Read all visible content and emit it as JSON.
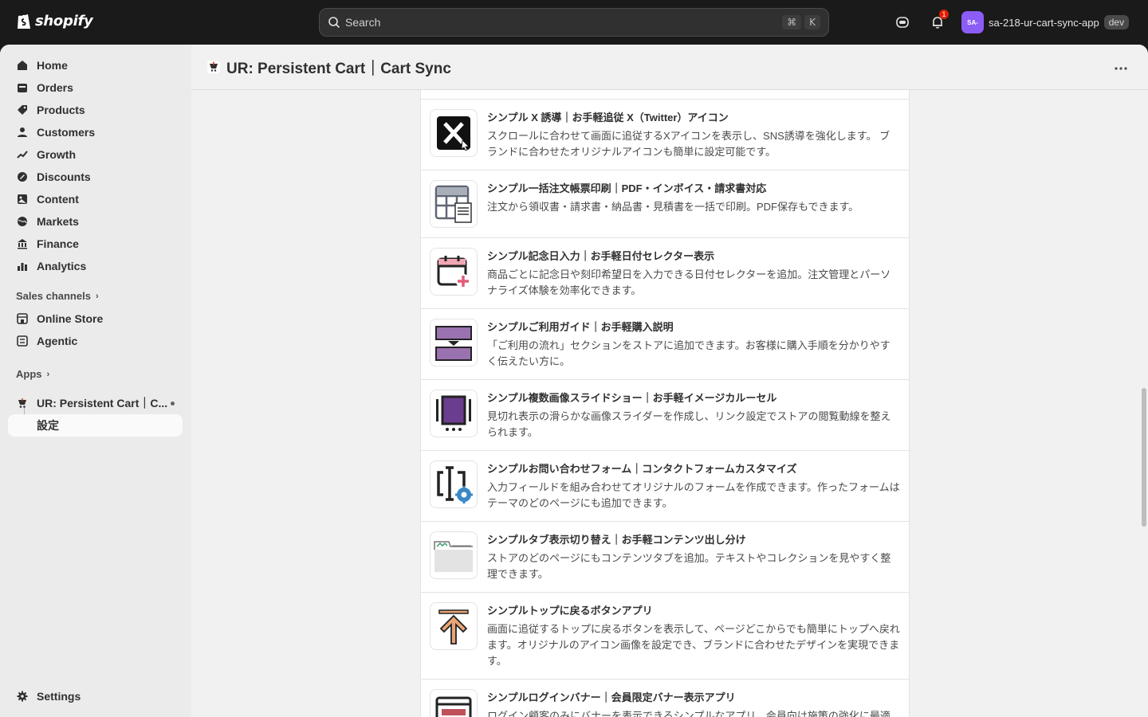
{
  "topbar": {
    "logo_text": "shopify",
    "search_placeholder": "Search",
    "shortcut_cmd": "⌘",
    "shortcut_key": "K",
    "notification_count": "1",
    "avatar_initials": "SA-",
    "account_name": "sa-218-ur-cart-sync-app",
    "env_badge": "dev"
  },
  "sidebar": {
    "items": [
      {
        "label": "Home",
        "icon": "home-icon"
      },
      {
        "label": "Orders",
        "icon": "orders-icon"
      },
      {
        "label": "Products",
        "icon": "tag-icon"
      },
      {
        "label": "Customers",
        "icon": "person-icon"
      },
      {
        "label": "Growth",
        "icon": "growth-icon"
      },
      {
        "label": "Discounts",
        "icon": "discount-icon"
      },
      {
        "label": "Content",
        "icon": "content-icon"
      },
      {
        "label": "Markets",
        "icon": "globe-icon"
      },
      {
        "label": "Finance",
        "icon": "bank-icon"
      },
      {
        "label": "Analytics",
        "icon": "chart-icon"
      }
    ],
    "sales_channels_label": "Sales channels",
    "channels": [
      {
        "label": "Online Store",
        "icon": "store-icon"
      },
      {
        "label": "Agentic",
        "icon": "agentic-icon"
      }
    ],
    "apps_label": "Apps",
    "app_name": "UR: Persistent Cart｜C...",
    "app_sub_item": "設定",
    "settings_label": "Settings"
  },
  "header": {
    "title": "UR: Persistent Cart｜Cart Sync"
  },
  "apps_list": [
    {
      "title": "シンプル X 誘導｜お手軽追従 X（Twitter）アイコン",
      "desc": "スクロールに合わせて画面に追従するXアイコンを表示し、SNS誘導を強化します。 ブランドに合わせたオリジナルアイコンも簡単に設定可能です。",
      "icon": "x-logo-icon"
    },
    {
      "title": "シンプル一括注文帳票印刷｜PDF・インボイス・請求書対応",
      "desc": "注文から領収書・請求書・納品書・見積書を一括で印刷。PDF保存もできます。",
      "icon": "invoice-table-icon"
    },
    {
      "title": "シンプル記念日入力｜お手軽日付セレクター表示",
      "desc": "商品ごとに記念日や刻印希望日を入力できる日付セレクターを追加。注文管理とパーソナライズ体験を効率化できます。",
      "icon": "calendar-add-icon"
    },
    {
      "title": "シンプルご利用ガイド｜お手軽購入説明",
      "desc": "「ご利用の流れ」セクションをストアに追加できます。お客様に購入手順を分かりやすく伝えたい方に。",
      "icon": "guide-steps-icon"
    },
    {
      "title": "シンプル複数画像スライドショー｜お手軽イメージカルーセル",
      "desc": "見切れ表示の滑らかな画像スライダーを作成し、リンク設定でストアの閲覧動線を整えられます。",
      "icon": "carousel-icon"
    },
    {
      "title": "シンプルお問い合わせフォーム｜コンタクトフォームカスタマイズ",
      "desc": "入力フィールドを組み合わせてオリジナルのフォームを作成できます。作ったフォームはテーマのどのページにも追加できます。",
      "icon": "form-settings-icon"
    },
    {
      "title": "シンプルタブ表示切り替え｜お手軽コンテンツ出し分け",
      "desc": "ストアのどのページにもコンテンツタブを追加。テキストやコレクションを見やすく整理できます。",
      "icon": "tabs-icon"
    },
    {
      "title": "シンプルトップに戻るボタンアプリ",
      "desc": "画面に追従するトップに戻るボタンを表示して、ページどこからでも簡単にトップへ戻れます。オリジナルのアイコン画像を設定でき、ブランドに合わせたデザインを実現できます。",
      "icon": "arrow-up-icon"
    },
    {
      "title": "シンプルログインバナー｜会員限定バナー表示アプリ",
      "desc": "ログイン顧客のみにバナーを表示できるシンプルなアプリ。会員向け施策の強化に最適",
      "icon": "login-banner-icon"
    }
  ]
}
